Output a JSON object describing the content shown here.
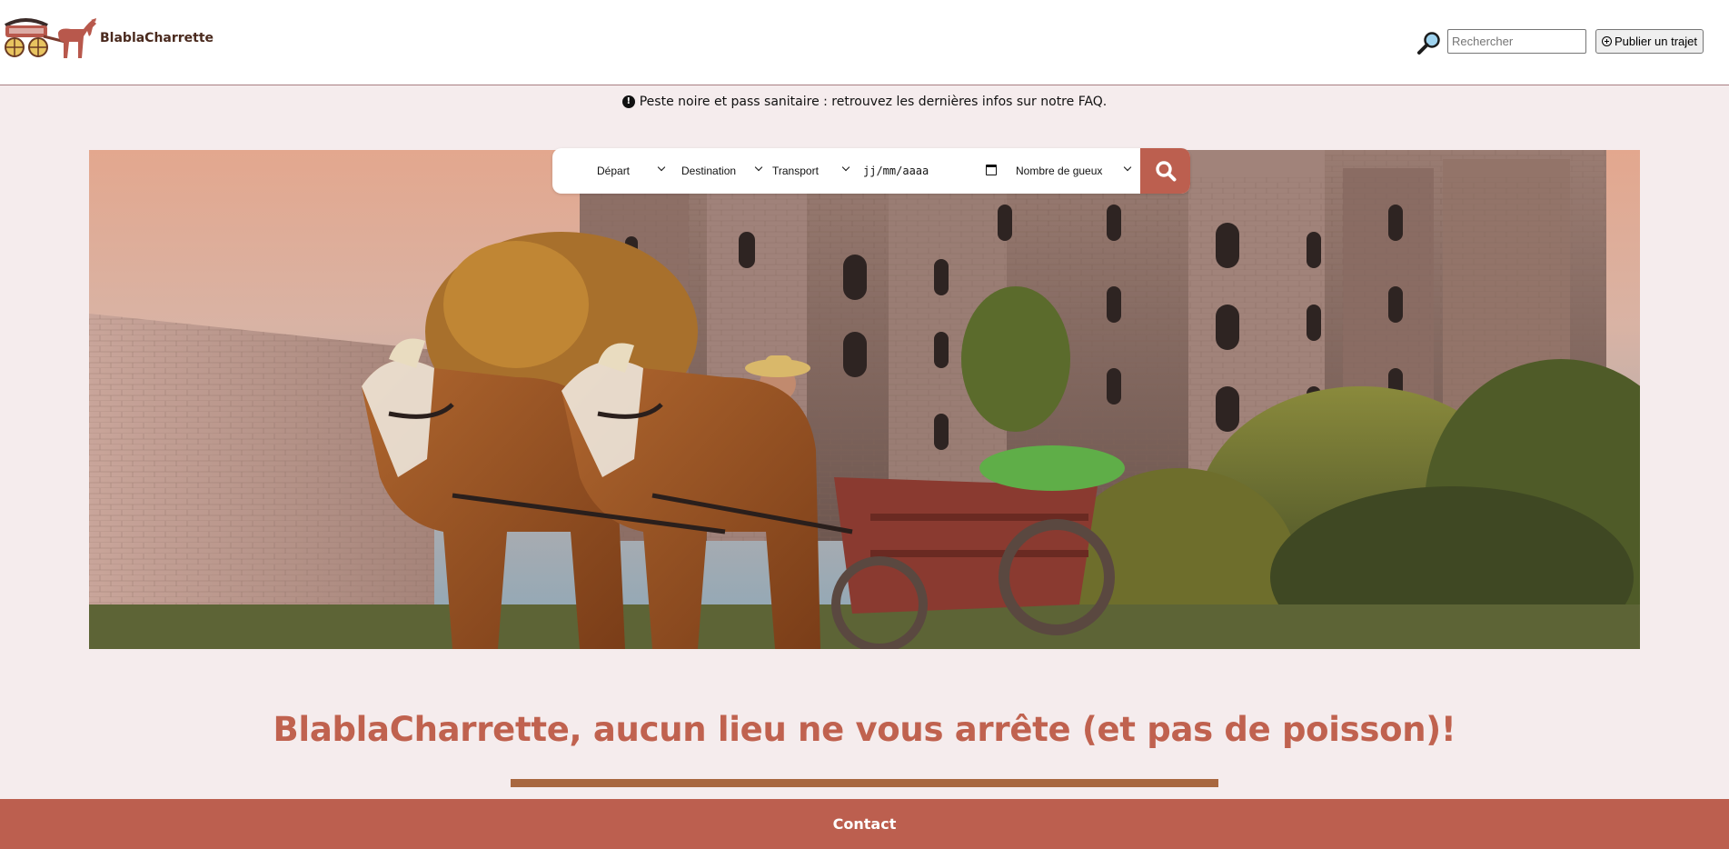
{
  "header": {
    "brand": "BlablaCharrette",
    "logo_icon": "horse-cart-logo",
    "search_icon": "magnifier-icon",
    "search_placeholder": "Rechercher",
    "publish_label": "Publier un trajet",
    "publish_icon": "plus-circle-icon"
  },
  "notice": {
    "icon": "exclamation-circle-icon",
    "text": "Peste noire et pass sanitaire : retrouvez les dernières infos sur notre FAQ."
  },
  "search_form": {
    "depart": "Départ",
    "destination": "Destination",
    "transport": "Transport",
    "date_placeholder": "jj/mm/aaaa",
    "passengers": "Nombre de gueux",
    "submit_icon": "search-icon"
  },
  "hero": {
    "image": "horse-drawn-cart-castle-photo"
  },
  "slogan": "BlablaCharrette, aucun lieu ne vous arrête (et pas de poisson)!",
  "footer": {
    "contact": "Contact"
  },
  "colors": {
    "accent": "#bc5f4f",
    "slogan": "#c0624f",
    "divider": "#a8673f",
    "page_bg": "#f5eced",
    "brand_text": "#4a2a1e"
  }
}
